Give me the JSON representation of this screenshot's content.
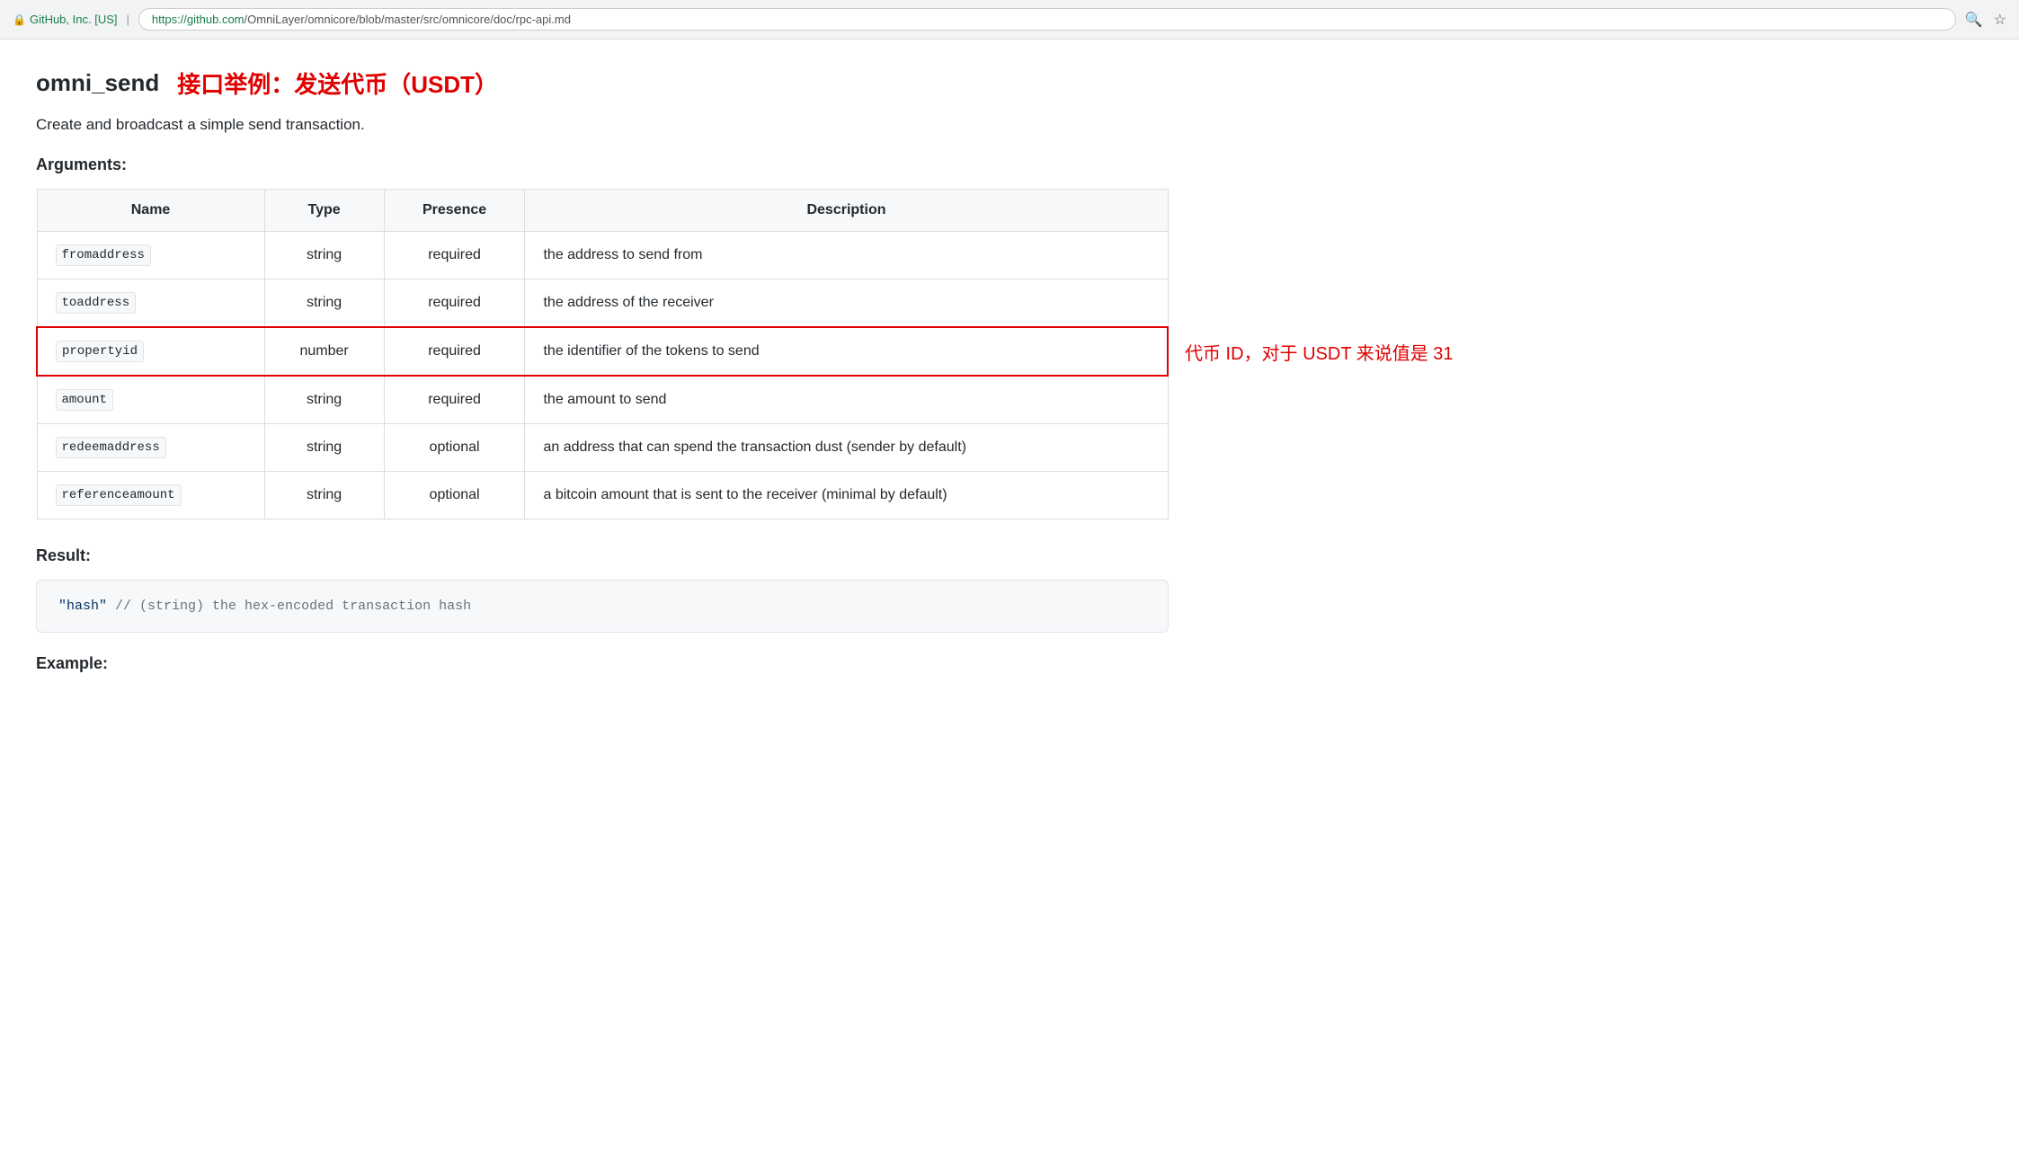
{
  "browser": {
    "security_label": "GitHub, Inc. [US]",
    "separator": "|",
    "url_green": "https://github.com",
    "url_gray": "/OmniLayer/omnicore/blob/master/src/omnicore/doc/rpc-api.md",
    "search_icon": "🔍",
    "star_icon": "☆"
  },
  "page": {
    "title_main": "omni_send",
    "title_chinese": "接口举例：发送代币（USDT）",
    "description": "Create and broadcast a simple send transaction.",
    "arguments_heading": "Arguments:",
    "result_heading": "Result:",
    "example_heading": "Example:",
    "table": {
      "headers": [
        "Name",
        "Type",
        "Presence",
        "Description"
      ],
      "rows": [
        {
          "name": "fromaddress",
          "type": "string",
          "presence": "required",
          "description": "the address to send from",
          "highlighted": false
        },
        {
          "name": "toaddress",
          "type": "string",
          "presence": "required",
          "description": "the address of the receiver",
          "highlighted": false
        },
        {
          "name": "propertyid",
          "type": "number",
          "presence": "required",
          "description": "the identifier of the tokens to send",
          "highlighted": true,
          "annotation": "代币 ID，对于 USDT 来说值是 31"
        },
        {
          "name": "amount",
          "type": "string",
          "presence": "required",
          "description": "the amount to send",
          "highlighted": false
        },
        {
          "name": "redeemaddress",
          "type": "string",
          "presence": "optional",
          "description": "an address that can spend the transaction dust (sender by default)",
          "highlighted": false
        },
        {
          "name": "referenceamount",
          "type": "string",
          "presence": "optional",
          "description": "a bitcoin amount that is sent to the receiver (minimal by default)",
          "highlighted": false
        }
      ]
    },
    "result_code": "\"hash\"  // (string) the hex-encoded transaction hash"
  }
}
